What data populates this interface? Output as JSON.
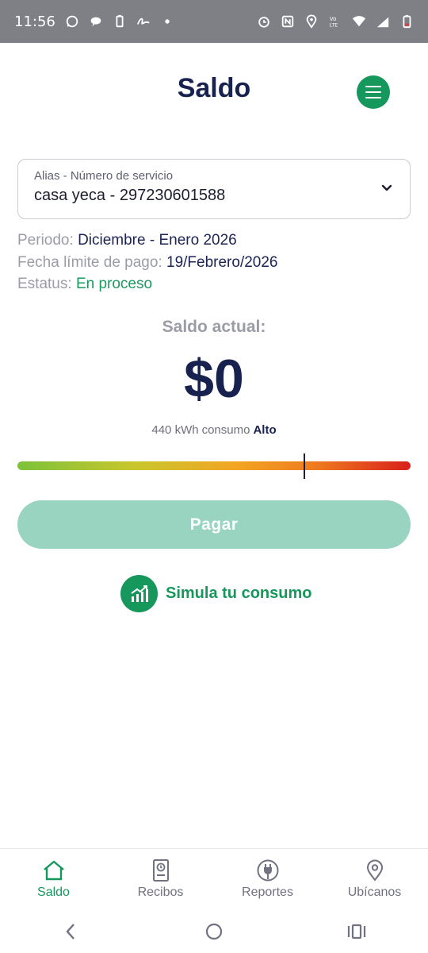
{
  "status_bar": {
    "time": "11:56",
    "icons_left": [
      "whatsapp-icon",
      "chat-icon",
      "battery-saver-icon",
      "signature-icon",
      "dot-icon"
    ],
    "icons_right": [
      "alarm-icon",
      "nfc-icon",
      "location-icon",
      "volte-icon",
      "wifi-icon",
      "signal-4g-icon",
      "battery-icon"
    ]
  },
  "header": {
    "title": "Saldo",
    "menu_icon": "hamburger-menu-icon"
  },
  "service": {
    "label": "Alias - Número de servicio",
    "value": "casa yeca - 297230601588"
  },
  "details": {
    "period_label": "Periodo:",
    "period_value": "Diciembre - Enero 2026",
    "due_label": "Fecha límite de pago:",
    "due_value": "19/Febrero/2026",
    "status_label": "Estatus:",
    "status_value": "En proceso"
  },
  "balance": {
    "label": "Saldo actual:",
    "amount": "$0",
    "consumption_value": "440 kWh",
    "consumption_word": "consumo",
    "consumption_level": "Alto"
  },
  "meter": {
    "level_fraction": 0.73,
    "colors": [
      "#7cc23a",
      "#c9c62c",
      "#f2a623",
      "#ef7d1f",
      "#d8201c"
    ]
  },
  "actions": {
    "pay_label": "Pagar",
    "simulate_label": "Simula tu consumo"
  },
  "bottom_nav": {
    "items": [
      {
        "label": "Saldo",
        "icon": "home-icon",
        "active": true
      },
      {
        "label": "Recibos",
        "icon": "receipt-icon",
        "active": false
      },
      {
        "label": "Reportes",
        "icon": "plug-icon",
        "active": false
      },
      {
        "label": "Ubícanos",
        "icon": "location-pin-icon",
        "active": false
      }
    ]
  },
  "colors": {
    "brand_green": "#16975b",
    "navy": "#18224f",
    "pay_disabled": "#98d4bf"
  }
}
